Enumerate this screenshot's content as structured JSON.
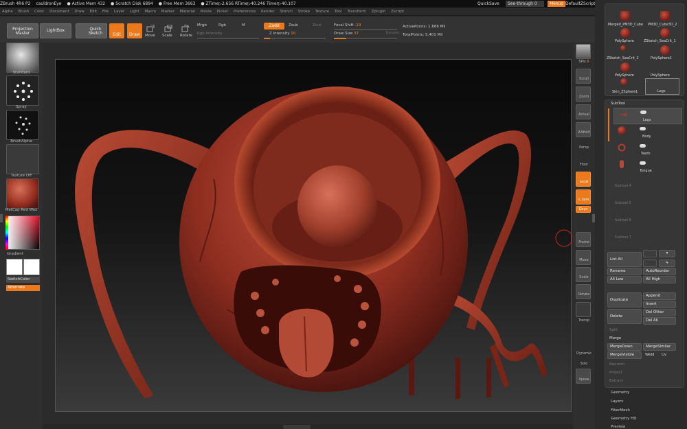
{
  "titlebar": {
    "items": [
      "ZBrush 4R6 P2",
      "cauldronEye",
      "● Active Mem 432",
      "● Scratch Disk 6894",
      "● Free Mem 3663",
      "● ZTime▷2.656 RTime▷40.246 Timer▷40.107"
    ],
    "quicksave": "QuickSave",
    "seethrough": "See-through 0",
    "menus": "Menus",
    "script": "DefaultZScript"
  },
  "menubar": [
    "Alpha",
    "Brush",
    "Color",
    "Document",
    "Draw",
    "Edit",
    "File",
    "Layer",
    "Light",
    "Macro",
    "Marker",
    "Material",
    "Movie",
    "Picker",
    "Preferences",
    "Render",
    "Stencil",
    "Stroke",
    "Texture",
    "Tool",
    "Transform",
    "Zplugin",
    "Zscript"
  ],
  "shelf": {
    "projection_master": "Projection Master",
    "lightbox": "LightBox",
    "quick_sketch": "Quick Sketch",
    "edit": "Edit",
    "draw": "Draw",
    "move": "Move",
    "scale": "Scale",
    "rotate": "Rotate",
    "mrgb": "Mrgb",
    "rgb": "Rgb",
    "m": "M",
    "rgb_intensity": "Rgb Intensity",
    "zadd": "Zadd",
    "zsub": "Zsub",
    "zcut": "Zcut",
    "z_intensity_label": "Z Intensity",
    "z_intensity_value": "10",
    "focal_shift_label": "Focal Shift",
    "focal_shift_value": "-19",
    "draw_size_label": "Draw Size",
    "draw_size_value": "37",
    "dynamic": "Dynamic",
    "active_points": "ActivePoints: 1.666 Mil",
    "total_points": "TotalPoints: 5.401 Mil"
  },
  "leftpal": {
    "brush": "Standard",
    "stroke": "Spray",
    "alpha": "BrushAlpha",
    "texture": "Texture Off",
    "material": "MatCap Red Wax",
    "gradient": "Gradient",
    "switchcolor": "SwitchColor",
    "alternate": "Alternate"
  },
  "rightshelf": {
    "spix_label": "SPix",
    "spix_value": "6",
    "scroll": "Scroll",
    "zoom": "Zoom",
    "actual": "Actual",
    "aahalf": "AAHalf",
    "persp": "Persp",
    "floor": "Floor",
    "local": "Local",
    "lsym": "L.Sym",
    "xyz": "Qxyz",
    "frame": "Frame",
    "move": "Move",
    "scale": "Scale",
    "rotate": "Rotate",
    "polyf": "PolyF",
    "transp": "Transp",
    "ghost": "Ghost",
    "dynamic": "Dynamic",
    "solo": "Solo",
    "xpose": "Xpose"
  },
  "tools": [
    {
      "name": "Merged_PM3D_Cube"
    },
    {
      "name": "PM3D_Cube3D_2"
    },
    {
      "name": "PolySphere"
    },
    {
      "name": "ZSketch_SeaCrit_1"
    },
    {
      "name": "ZSketch_SeaCrit_2"
    },
    {
      "name": "PolySphere1"
    },
    {
      "name": "PolySphere"
    },
    {
      "name": "PolySphere"
    },
    {
      "name": "Skin_ZSphere1"
    },
    {
      "name": "Legs"
    }
  ],
  "subtool": {
    "header": "SubTool",
    "items": [
      {
        "name": "Legs",
        "active": true
      },
      {
        "name": "Body",
        "active": false
      },
      {
        "name": "Teeth",
        "active": false
      },
      {
        "name": "Tongue",
        "active": false
      }
    ],
    "empty_slots": [
      "Subtool 4",
      "Subtool 5",
      "Subtool 6",
      "Subtool 7"
    ]
  },
  "subtool_buttons": {
    "list_all": "List All",
    "rename": "Rename",
    "autoreorder": "AutoReorder",
    "all_low": "All Low",
    "all_high": "All High",
    "duplicate": "Duplicate",
    "append": "Append",
    "insert": "Insert",
    "delete": "Delete",
    "del_other": "Del Other",
    "del_all": "Del All",
    "split": "Split",
    "merge": "Merge",
    "mergedown": "MergeDown",
    "mergesimilar": "MergeSimilar",
    "mergevisible": "MergeVisible",
    "weld": "Weld",
    "uv": "Uv",
    "remesh": "Remesh",
    "project": "Project",
    "extract": "Extract"
  },
  "tool_sections": [
    "Geometry",
    "Layers",
    "FiberMesh",
    "Geometry HD",
    "Preview"
  ],
  "colors": {
    "accent": "#ec7a1c",
    "model": "#a83a2a",
    "model_dark": "#5e1a12",
    "model_light": "#d4634c"
  }
}
